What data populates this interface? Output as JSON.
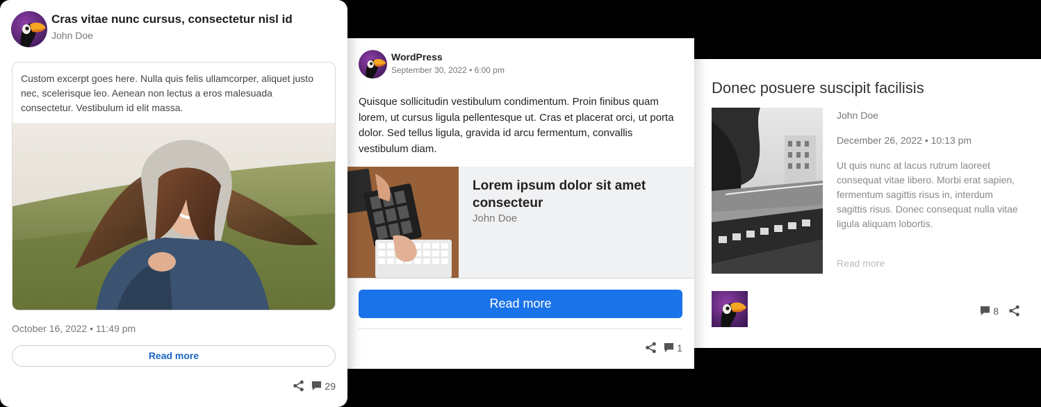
{
  "card1": {
    "title": "Cras vitae nunc cursus, consectetur nisl id",
    "author": "John Doe",
    "excerpt": "Custom excerpt goes here. Nulla quis felis ullamcorper, aliquet justo nec, scelerisque leo. Aenean non lectus a eros malesuada consectetur. Vestibulum id elit massa.",
    "date": "October 16, 2022 • 11:49 pm",
    "read_more": "Read more",
    "comments": "29",
    "icons": {
      "avatar": "toucan-avatar",
      "share": "share-icon",
      "comment": "comment-icon"
    }
  },
  "card2": {
    "author": "WordPress",
    "date": "September 30, 2022 • 6:00 pm",
    "text": "Quisque sollicitudin vestibulum condimentum. Proin finibus quam lorem, ut cursus ligula pellentesque ut. Cras et placerat orci, ut porta dolor. Sed tellus ligula, gravida id arcu fermentum, convallis vestibulum diam.",
    "embed": {
      "title": "Lorem ipsum dolor sit amet consecteur",
      "author": "John Doe"
    },
    "read_more": "Read more",
    "comments": "1",
    "accent": "#1a73e8"
  },
  "card3": {
    "title": "Donec posuere suscipit facilisis",
    "author": "John Doe",
    "date": "December 26, 2022 • 10:13 pm",
    "excerpt": "Ut quis nunc at lacus rutrum laoreet consequat vitae libero. Morbi erat sapien, fermentum sagittis risus in, interdum sagittis risus. Donec consequat nulla vitae ligula aliquam lobortis.",
    "read_more": "Read more",
    "comments": "8"
  }
}
